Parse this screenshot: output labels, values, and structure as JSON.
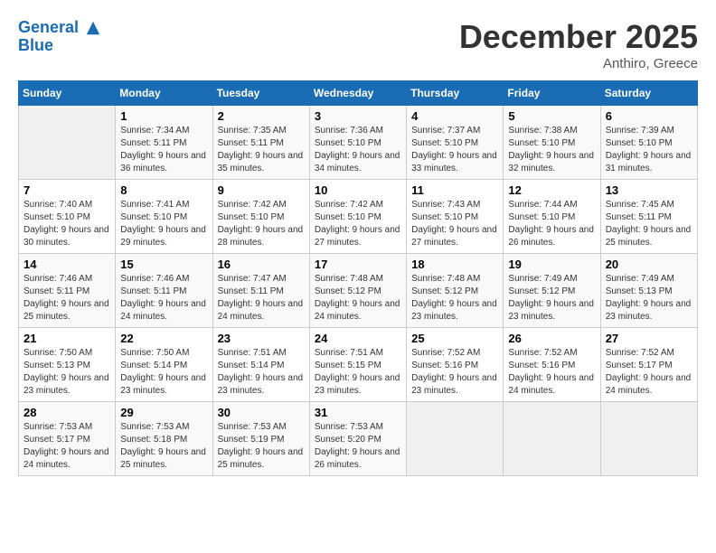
{
  "header": {
    "logo_line1": "General",
    "logo_line2": "Blue",
    "month": "December 2025",
    "location": "Anthiro, Greece"
  },
  "weekdays": [
    "Sunday",
    "Monday",
    "Tuesday",
    "Wednesday",
    "Thursday",
    "Friday",
    "Saturday"
  ],
  "weeks": [
    [
      {
        "day": "",
        "sunrise": "",
        "sunset": "",
        "daylight": ""
      },
      {
        "day": "1",
        "sunrise": "Sunrise: 7:34 AM",
        "sunset": "Sunset: 5:11 PM",
        "daylight": "Daylight: 9 hours and 36 minutes."
      },
      {
        "day": "2",
        "sunrise": "Sunrise: 7:35 AM",
        "sunset": "Sunset: 5:11 PM",
        "daylight": "Daylight: 9 hours and 35 minutes."
      },
      {
        "day": "3",
        "sunrise": "Sunrise: 7:36 AM",
        "sunset": "Sunset: 5:10 PM",
        "daylight": "Daylight: 9 hours and 34 minutes."
      },
      {
        "day": "4",
        "sunrise": "Sunrise: 7:37 AM",
        "sunset": "Sunset: 5:10 PM",
        "daylight": "Daylight: 9 hours and 33 minutes."
      },
      {
        "day": "5",
        "sunrise": "Sunrise: 7:38 AM",
        "sunset": "Sunset: 5:10 PM",
        "daylight": "Daylight: 9 hours and 32 minutes."
      },
      {
        "day": "6",
        "sunrise": "Sunrise: 7:39 AM",
        "sunset": "Sunset: 5:10 PM",
        "daylight": "Daylight: 9 hours and 31 minutes."
      }
    ],
    [
      {
        "day": "7",
        "sunrise": "Sunrise: 7:40 AM",
        "sunset": "Sunset: 5:10 PM",
        "daylight": "Daylight: 9 hours and 30 minutes."
      },
      {
        "day": "8",
        "sunrise": "Sunrise: 7:41 AM",
        "sunset": "Sunset: 5:10 PM",
        "daylight": "Daylight: 9 hours and 29 minutes."
      },
      {
        "day": "9",
        "sunrise": "Sunrise: 7:42 AM",
        "sunset": "Sunset: 5:10 PM",
        "daylight": "Daylight: 9 hours and 28 minutes."
      },
      {
        "day": "10",
        "sunrise": "Sunrise: 7:42 AM",
        "sunset": "Sunset: 5:10 PM",
        "daylight": "Daylight: 9 hours and 27 minutes."
      },
      {
        "day": "11",
        "sunrise": "Sunrise: 7:43 AM",
        "sunset": "Sunset: 5:10 PM",
        "daylight": "Daylight: 9 hours and 27 minutes."
      },
      {
        "day": "12",
        "sunrise": "Sunrise: 7:44 AM",
        "sunset": "Sunset: 5:10 PM",
        "daylight": "Daylight: 9 hours and 26 minutes."
      },
      {
        "day": "13",
        "sunrise": "Sunrise: 7:45 AM",
        "sunset": "Sunset: 5:11 PM",
        "daylight": "Daylight: 9 hours and 25 minutes."
      }
    ],
    [
      {
        "day": "14",
        "sunrise": "Sunrise: 7:46 AM",
        "sunset": "Sunset: 5:11 PM",
        "daylight": "Daylight: 9 hours and 25 minutes."
      },
      {
        "day": "15",
        "sunrise": "Sunrise: 7:46 AM",
        "sunset": "Sunset: 5:11 PM",
        "daylight": "Daylight: 9 hours and 24 minutes."
      },
      {
        "day": "16",
        "sunrise": "Sunrise: 7:47 AM",
        "sunset": "Sunset: 5:11 PM",
        "daylight": "Daylight: 9 hours and 24 minutes."
      },
      {
        "day": "17",
        "sunrise": "Sunrise: 7:48 AM",
        "sunset": "Sunset: 5:12 PM",
        "daylight": "Daylight: 9 hours and 24 minutes."
      },
      {
        "day": "18",
        "sunrise": "Sunrise: 7:48 AM",
        "sunset": "Sunset: 5:12 PM",
        "daylight": "Daylight: 9 hours and 23 minutes."
      },
      {
        "day": "19",
        "sunrise": "Sunrise: 7:49 AM",
        "sunset": "Sunset: 5:12 PM",
        "daylight": "Daylight: 9 hours and 23 minutes."
      },
      {
        "day": "20",
        "sunrise": "Sunrise: 7:49 AM",
        "sunset": "Sunset: 5:13 PM",
        "daylight": "Daylight: 9 hours and 23 minutes."
      }
    ],
    [
      {
        "day": "21",
        "sunrise": "Sunrise: 7:50 AM",
        "sunset": "Sunset: 5:13 PM",
        "daylight": "Daylight: 9 hours and 23 minutes."
      },
      {
        "day": "22",
        "sunrise": "Sunrise: 7:50 AM",
        "sunset": "Sunset: 5:14 PM",
        "daylight": "Daylight: 9 hours and 23 minutes."
      },
      {
        "day": "23",
        "sunrise": "Sunrise: 7:51 AM",
        "sunset": "Sunset: 5:14 PM",
        "daylight": "Daylight: 9 hours and 23 minutes."
      },
      {
        "day": "24",
        "sunrise": "Sunrise: 7:51 AM",
        "sunset": "Sunset: 5:15 PM",
        "daylight": "Daylight: 9 hours and 23 minutes."
      },
      {
        "day": "25",
        "sunrise": "Sunrise: 7:52 AM",
        "sunset": "Sunset: 5:16 PM",
        "daylight": "Daylight: 9 hours and 23 minutes."
      },
      {
        "day": "26",
        "sunrise": "Sunrise: 7:52 AM",
        "sunset": "Sunset: 5:16 PM",
        "daylight": "Daylight: 9 hours and 24 minutes."
      },
      {
        "day": "27",
        "sunrise": "Sunrise: 7:52 AM",
        "sunset": "Sunset: 5:17 PM",
        "daylight": "Daylight: 9 hours and 24 minutes."
      }
    ],
    [
      {
        "day": "28",
        "sunrise": "Sunrise: 7:53 AM",
        "sunset": "Sunset: 5:17 PM",
        "daylight": "Daylight: 9 hours and 24 minutes."
      },
      {
        "day": "29",
        "sunrise": "Sunrise: 7:53 AM",
        "sunset": "Sunset: 5:18 PM",
        "daylight": "Daylight: 9 hours and 25 minutes."
      },
      {
        "day": "30",
        "sunrise": "Sunrise: 7:53 AM",
        "sunset": "Sunset: 5:19 PM",
        "daylight": "Daylight: 9 hours and 25 minutes."
      },
      {
        "day": "31",
        "sunrise": "Sunrise: 7:53 AM",
        "sunset": "Sunset: 5:20 PM",
        "daylight": "Daylight: 9 hours and 26 minutes."
      },
      {
        "day": "",
        "sunrise": "",
        "sunset": "",
        "daylight": ""
      },
      {
        "day": "",
        "sunrise": "",
        "sunset": "",
        "daylight": ""
      },
      {
        "day": "",
        "sunrise": "",
        "sunset": "",
        "daylight": ""
      }
    ]
  ]
}
